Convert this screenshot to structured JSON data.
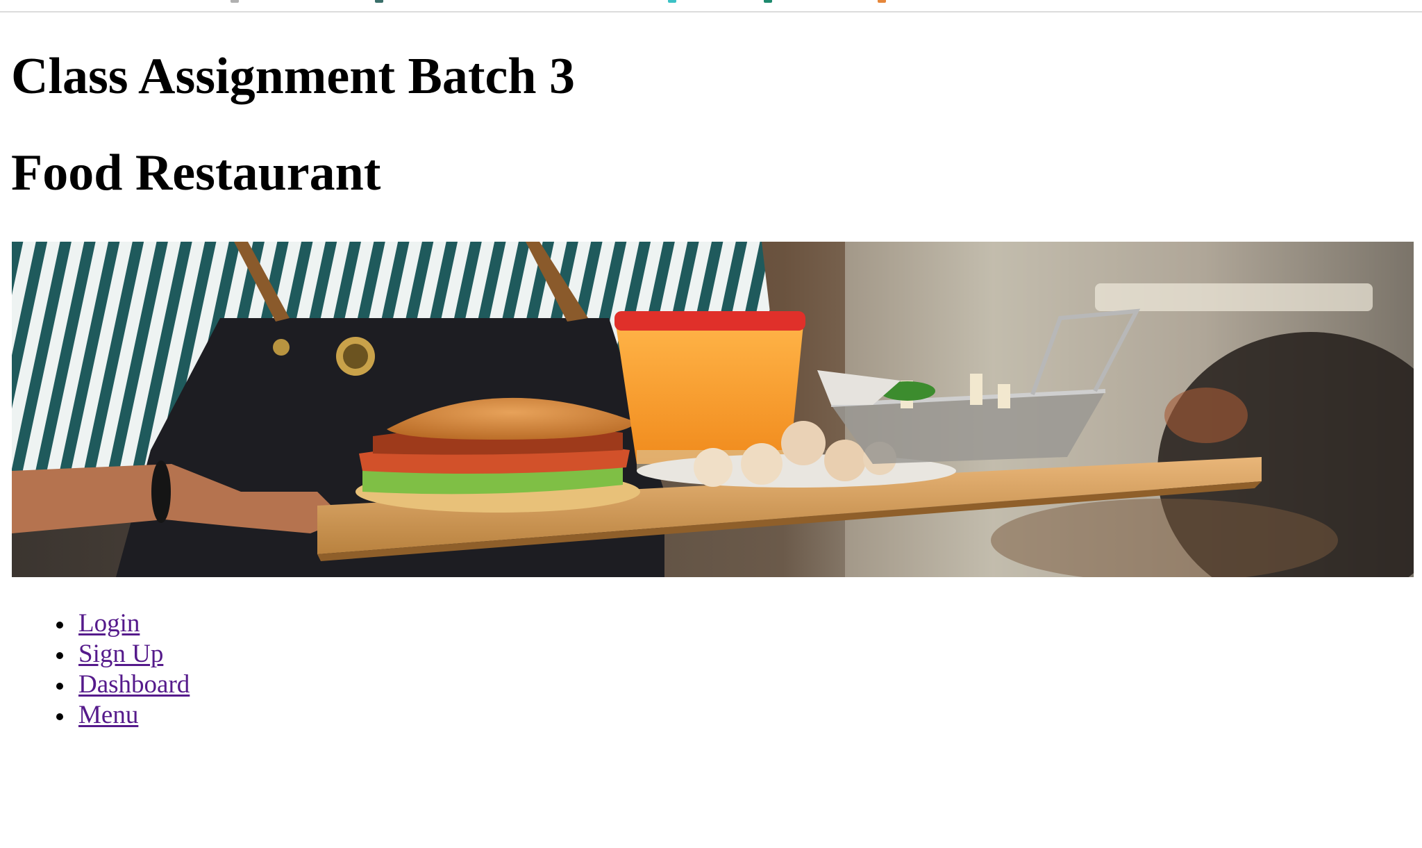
{
  "page": {
    "heading_1": "Class Assignment Batch 3",
    "heading_2": "Food Restaurant"
  },
  "hero_image": {
    "subject": "waiter carrying tray with burger, orange juice, fries basket and dessert balls"
  },
  "nav": {
    "items": [
      {
        "label": "Login"
      },
      {
        "label": "Sign Up"
      },
      {
        "label": "Dashboard"
      },
      {
        "label": "Menu"
      }
    ]
  },
  "colors": {
    "link_visited": "#551a8b",
    "text": "#000000",
    "background": "#ffffff"
  }
}
